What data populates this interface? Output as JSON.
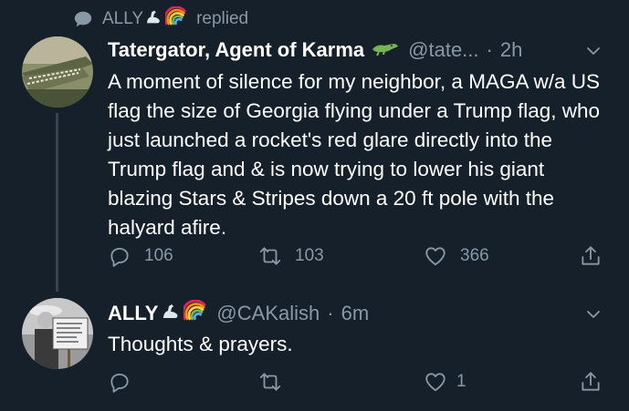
{
  "context": {
    "icon": "speech-bubble-icon",
    "name": "ALLY",
    "emojis": [
      "flexed-biceps-emoji",
      "rainbow-emoji"
    ],
    "action_text": "replied"
  },
  "tweets": [
    {
      "display_name": "Tatergator, Agent of Karma",
      "name_emoji": "crocodile-emoji",
      "handle": "@tate...",
      "dot": "·",
      "time": "2h",
      "text": "A moment of silence for my neighbor, a MAGA w/a US flag the size of Georgia flying under a Trump flag, who just launched a rocket's red glare directly into the Trump flag and & is now trying to lower his giant blazing Stars & Stripes down a 20 ft pole with the halyard afire.",
      "avatar": "alligator-photo",
      "replies": "106",
      "retweets": "103",
      "likes": "366"
    },
    {
      "display_name": "ALLY",
      "name_emojis": [
        "flexed-biceps-emoji",
        "rainbow-emoji"
      ],
      "handle": "@CAKalish",
      "dot": "·",
      "time": "6m",
      "text": "Thoughts & prayers.",
      "avatar": "protester-with-sign-photo",
      "replies": "",
      "retweets": "",
      "likes": "1"
    }
  ],
  "colors": {
    "background": "#15202b",
    "secondary_text": "#8899a6",
    "thread_line": "#38444d"
  }
}
